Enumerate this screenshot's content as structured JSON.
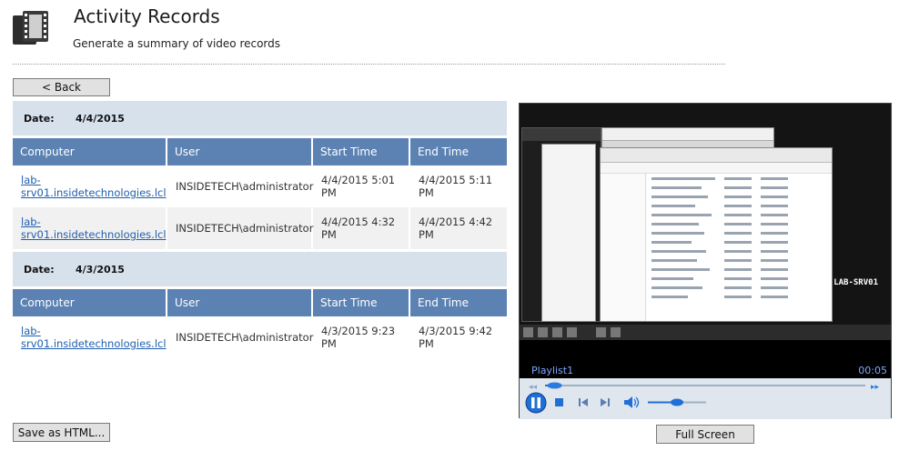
{
  "header": {
    "title": "Activity Records",
    "subtitle": "Generate a summary of video records",
    "icon": "film-strip-icon"
  },
  "buttons": {
    "back": "< Back",
    "save_html": "Save as HTML...",
    "full_screen": "Full Screen"
  },
  "columns": [
    "Computer",
    "User",
    "Start Time",
    "End Time"
  ],
  "date_label": "Date:",
  "groups": [
    {
      "date": "4/4/2015",
      "rows": [
        {
          "computer_1": "lab-",
          "computer_2": "srv01.insidetechnologies.lcl",
          "user": "INSIDETECH\\administrator",
          "start": "4/4/2015 5:01 PM",
          "end": "4/4/2015 5:11 PM"
        },
        {
          "computer_1": "lab-",
          "computer_2": "srv01.insidetechnologies.lcl",
          "user": "INSIDETECH\\administrator",
          "start": "4/4/2015 4:32 PM",
          "end": "4/4/2015 4:42 PM"
        }
      ]
    },
    {
      "date": "4/3/2015",
      "rows": [
        {
          "computer_1": "lab-",
          "computer_2": "srv01.insidetechnologies.lcl",
          "user": "INSIDETECH\\administrator",
          "start": "4/3/2015 9:23 PM",
          "end": "4/3/2015 9:42 PM"
        }
      ]
    }
  ],
  "player": {
    "playlist": "Playlist1",
    "time": "00:05",
    "server_name": "LAB-SRV01",
    "seek_position": 0.03,
    "volume": 0.5,
    "accent_color": "#1f6fd6"
  },
  "colors": {
    "date_bar": "#d7e1ec",
    "table_header": "#5c82b3",
    "link": "#1f5fae"
  }
}
